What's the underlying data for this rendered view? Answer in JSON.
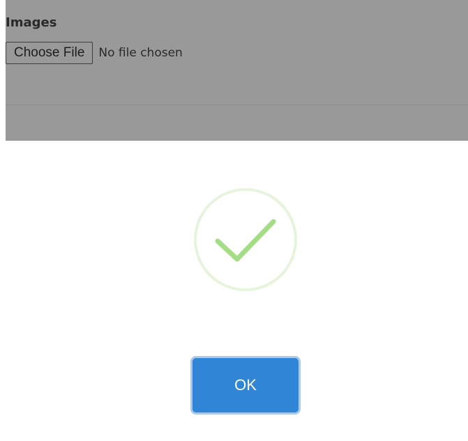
{
  "form": {
    "images_label": "Images",
    "choose_file_label": "Choose File",
    "file_status": "No file chosen"
  },
  "dialog": {
    "icon": "success-check-icon",
    "ok_label": "OK"
  },
  "colors": {
    "overlay": "#999999",
    "success_ring": "#e6f4dd",
    "success_check": "#a5dc86",
    "confirm_button": "#3085d6",
    "confirm_focus_ring": "#a8c8ec"
  }
}
